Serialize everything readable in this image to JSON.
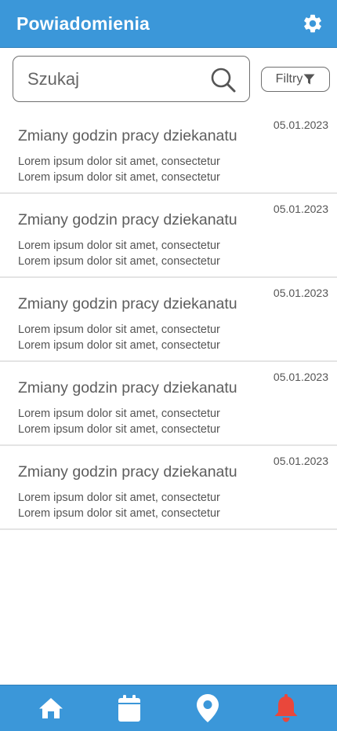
{
  "header": {
    "title": "Powiadomienia",
    "settings_icon": "gear-icon"
  },
  "search": {
    "placeholder": "Szukaj",
    "value": ""
  },
  "filter": {
    "label": "Filtry",
    "icon": "filter-icon"
  },
  "notifications": [
    {
      "title": "Zmiany godzin pracy dziekanatu",
      "date": "05.01.2023",
      "line1": "Lorem ipsum dolor sit amet, consectetur",
      "line2": "Lorem ipsum dolor sit amet, consectetur"
    },
    {
      "title": "Zmiany godzin pracy dziekanatu",
      "date": "05.01.2023",
      "line1": "Lorem ipsum dolor sit amet, consectetur",
      "line2": "Lorem ipsum dolor sit amet, consectetur"
    },
    {
      "title": "Zmiany godzin pracy dziekanatu",
      "date": "05.01.2023",
      "line1": "Lorem ipsum dolor sit amet, consectetur",
      "line2": "Lorem ipsum dolor sit amet, consectetur"
    },
    {
      "title": "Zmiany godzin pracy dziekanatu",
      "date": "05.01.2023",
      "line1": "Lorem ipsum dolor sit amet, consectetur",
      "line2": "Lorem ipsum dolor sit amet, consectetur"
    },
    {
      "title": "Zmiany godzin pracy dziekanatu",
      "date": "05.01.2023",
      "line1": "Lorem ipsum dolor sit amet, consectetur",
      "line2": "Lorem ipsum dolor sit amet, consectetur"
    }
  ],
  "bottom_nav": {
    "items": [
      {
        "icon": "home-icon",
        "active": false
      },
      {
        "icon": "calendar-icon",
        "active": false
      },
      {
        "icon": "map-pin-icon",
        "active": false
      },
      {
        "icon": "bell-icon",
        "active": true
      }
    ]
  },
  "colors": {
    "primary": "#3b97d9",
    "active_icon": "#e9473b",
    "icon": "#ffffff",
    "text": "#5d5d5d"
  }
}
